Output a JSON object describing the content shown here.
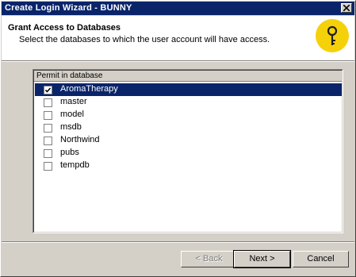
{
  "window": {
    "title": "Create Login Wizard - BUNNY"
  },
  "header": {
    "title": "Grant Access to Databases",
    "subtitle": "Select the databases to which the user account will have access.",
    "icon": "key-icon"
  },
  "list": {
    "column_header": "Permit in database",
    "items": [
      {
        "label": "AromaTherapy",
        "checked": true,
        "selected": true
      },
      {
        "label": "master",
        "checked": false,
        "selected": false
      },
      {
        "label": "model",
        "checked": false,
        "selected": false
      },
      {
        "label": "msdb",
        "checked": false,
        "selected": false
      },
      {
        "label": "Northwind",
        "checked": false,
        "selected": false
      },
      {
        "label": "pubs",
        "checked": false,
        "selected": false
      },
      {
        "label": "tempdb",
        "checked": false,
        "selected": false
      }
    ]
  },
  "buttons": {
    "back": "< Back",
    "next": "Next >",
    "cancel": "Cancel"
  },
  "colors": {
    "titlebar": "#0a246a",
    "selection": "#0a246a",
    "dialog_face": "#d4d0c8",
    "key_icon": "#f5d10a"
  }
}
